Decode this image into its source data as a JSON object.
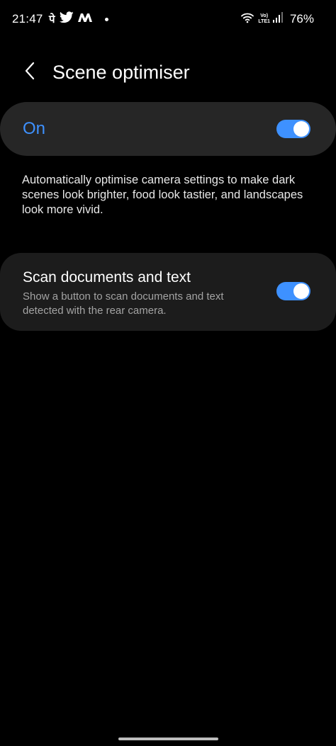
{
  "status_bar": {
    "time": "21:47",
    "phonepe_glyph": "पे",
    "notification_icons": [
      "phonepe-icon",
      "twitter-icon",
      "myntra-icon",
      "dot-icon"
    ],
    "network_label_top": "Vo)",
    "network_label_bottom": "LTE1",
    "battery": "76%",
    "status_icons": [
      "wifi-icon",
      "signal-icon",
      "battery-icon"
    ]
  },
  "header": {
    "back_icon": "chevron-left-icon",
    "title": "Scene optimiser"
  },
  "master_switch": {
    "label": "On",
    "enabled": true,
    "accent_color": "#3e91ff"
  },
  "description": "Automatically optimise camera settings to make dark scenes look brighter, food look tastier, and landscapes look more vivid.",
  "settings": [
    {
      "title": "Scan documents and text",
      "subtitle": "Show a button to scan documents and text detected with the rear camera.",
      "enabled": true
    }
  ],
  "colors": {
    "background": "#000000",
    "card": "#262626",
    "toggle_on": "#3e91ff",
    "secondary_text": "#a3a3a3"
  }
}
